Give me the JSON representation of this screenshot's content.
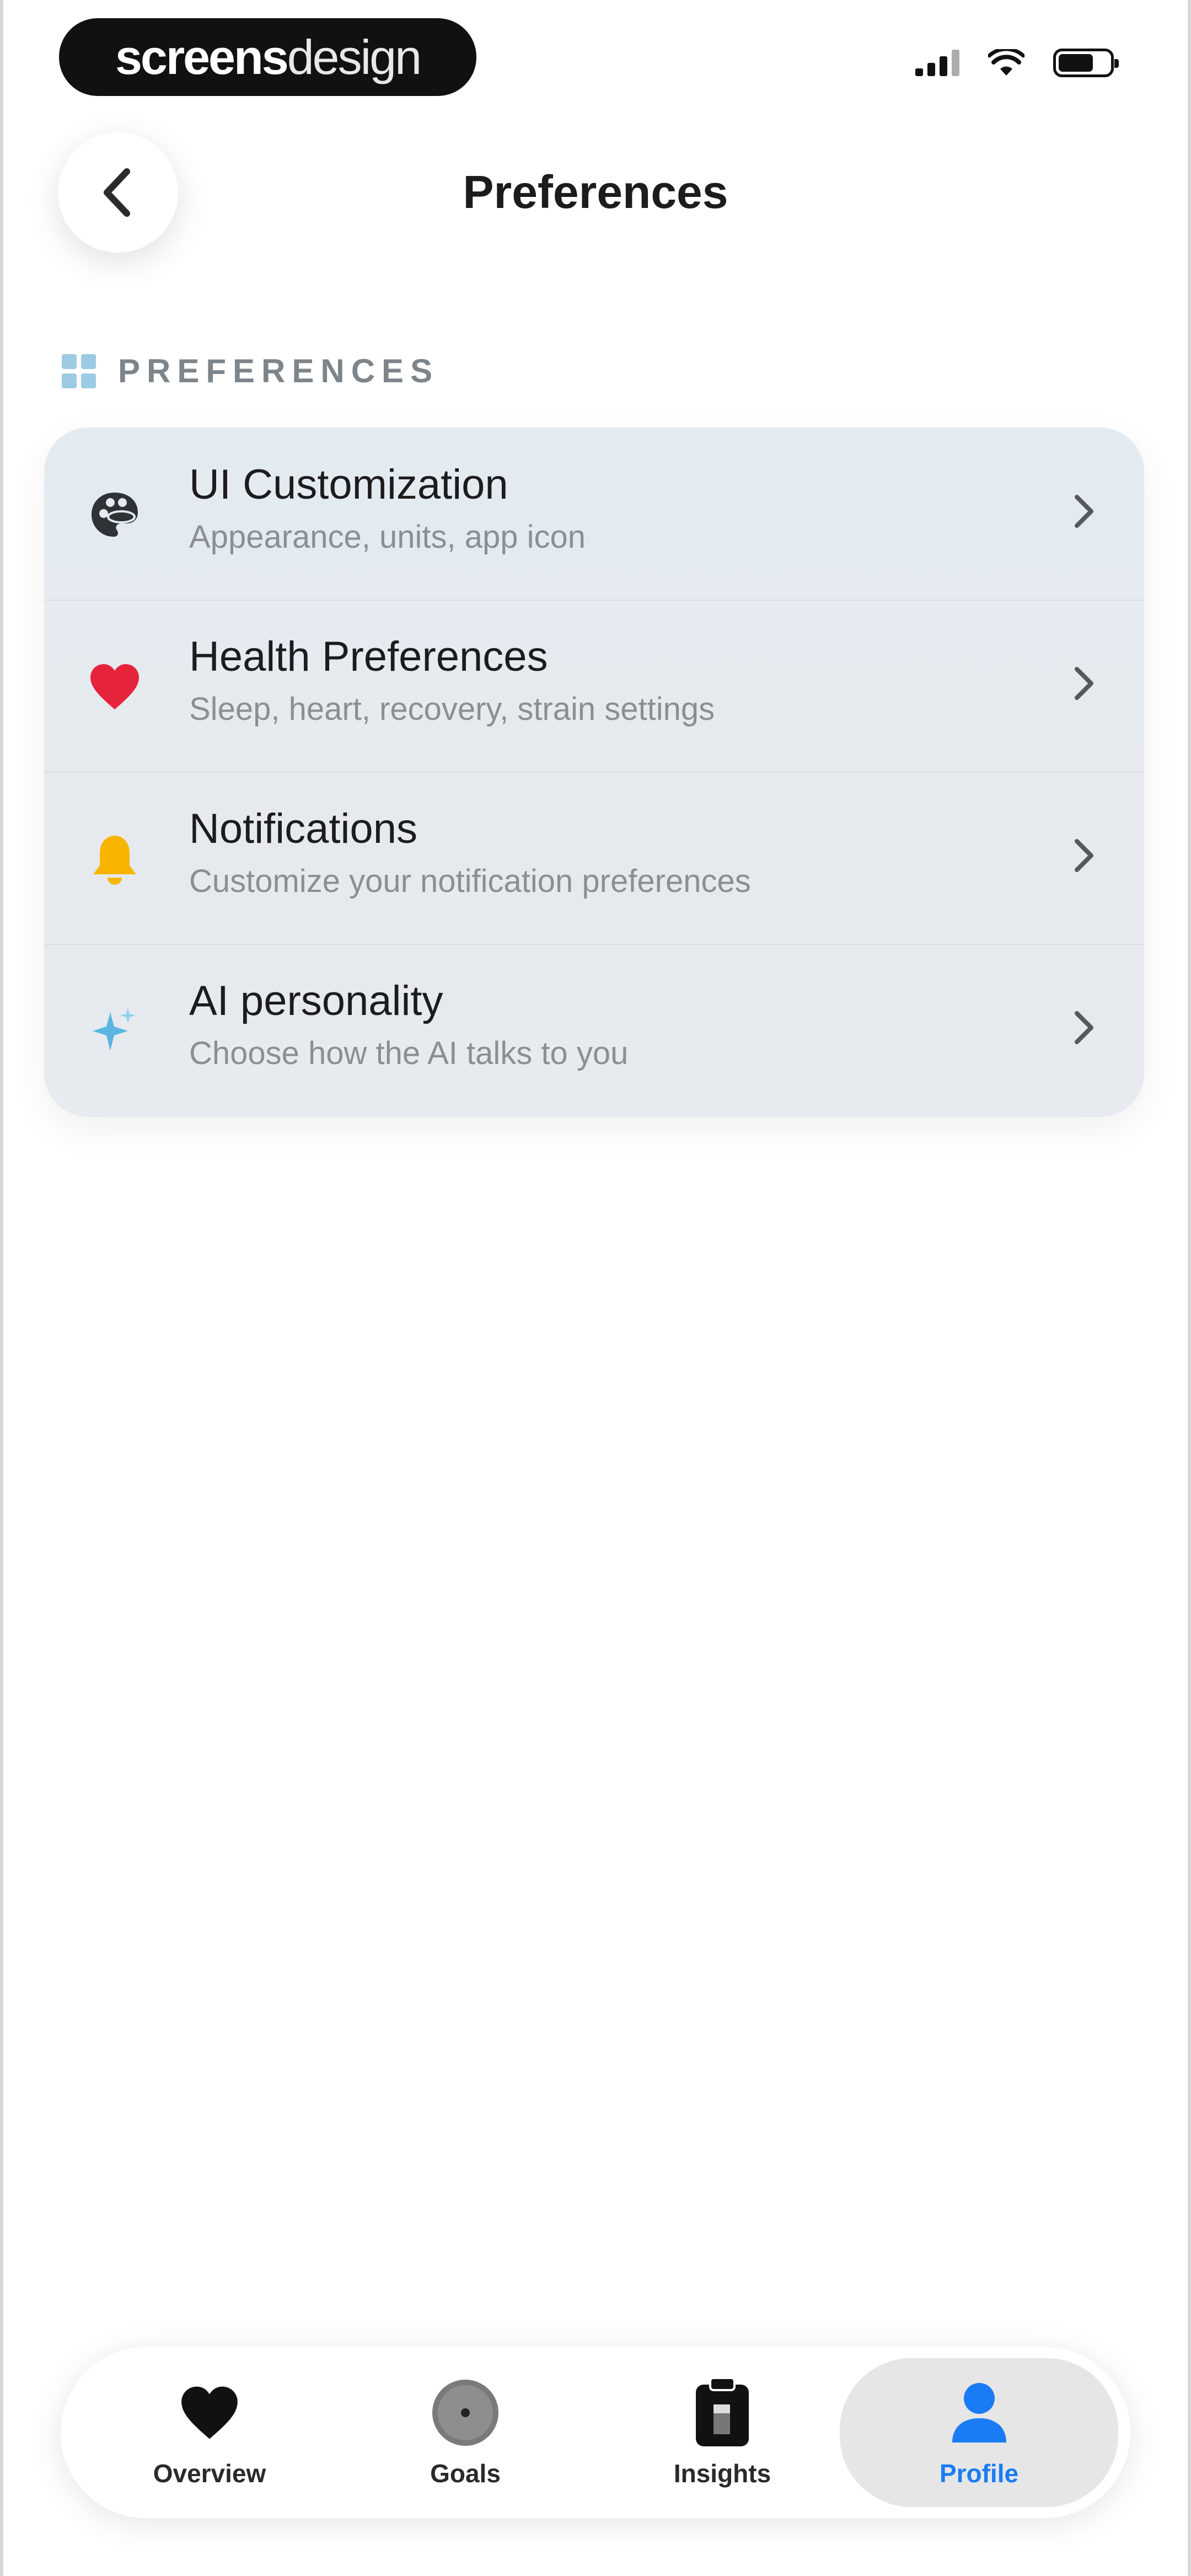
{
  "status_bar": {
    "brand_bold": "screens",
    "brand_light": "design"
  },
  "header": {
    "title": "Preferences"
  },
  "section": {
    "label": "PREFERENCES"
  },
  "items": [
    {
      "title": "UI Customization",
      "subtitle": "Appearance, units, app icon",
      "icon": "palette-icon"
    },
    {
      "title": "Health Preferences",
      "subtitle": "Sleep, heart, recovery, strain settings",
      "icon": "heart-icon"
    },
    {
      "title": "Notifications",
      "subtitle": "Customize your notification preferences",
      "icon": "bell-icon"
    },
    {
      "title": "AI personality",
      "subtitle": "Choose how the AI talks to you",
      "icon": "sparkle-icon"
    }
  ],
  "tabbar": {
    "tabs": [
      {
        "label": "Overview",
        "icon": "heart-icon"
      },
      {
        "label": "Goals",
        "icon": "target-icon"
      },
      {
        "label": "Insights",
        "icon": "clipboard-icon"
      },
      {
        "label": "Profile",
        "icon": "person-icon",
        "active": true
      }
    ]
  },
  "colors": {
    "accent": "#1a7cf5",
    "heart": "#e5243b",
    "bell": "#f7b500",
    "sparkle": "#5ab6e0",
    "section_icon": "#9ccbe3"
  }
}
